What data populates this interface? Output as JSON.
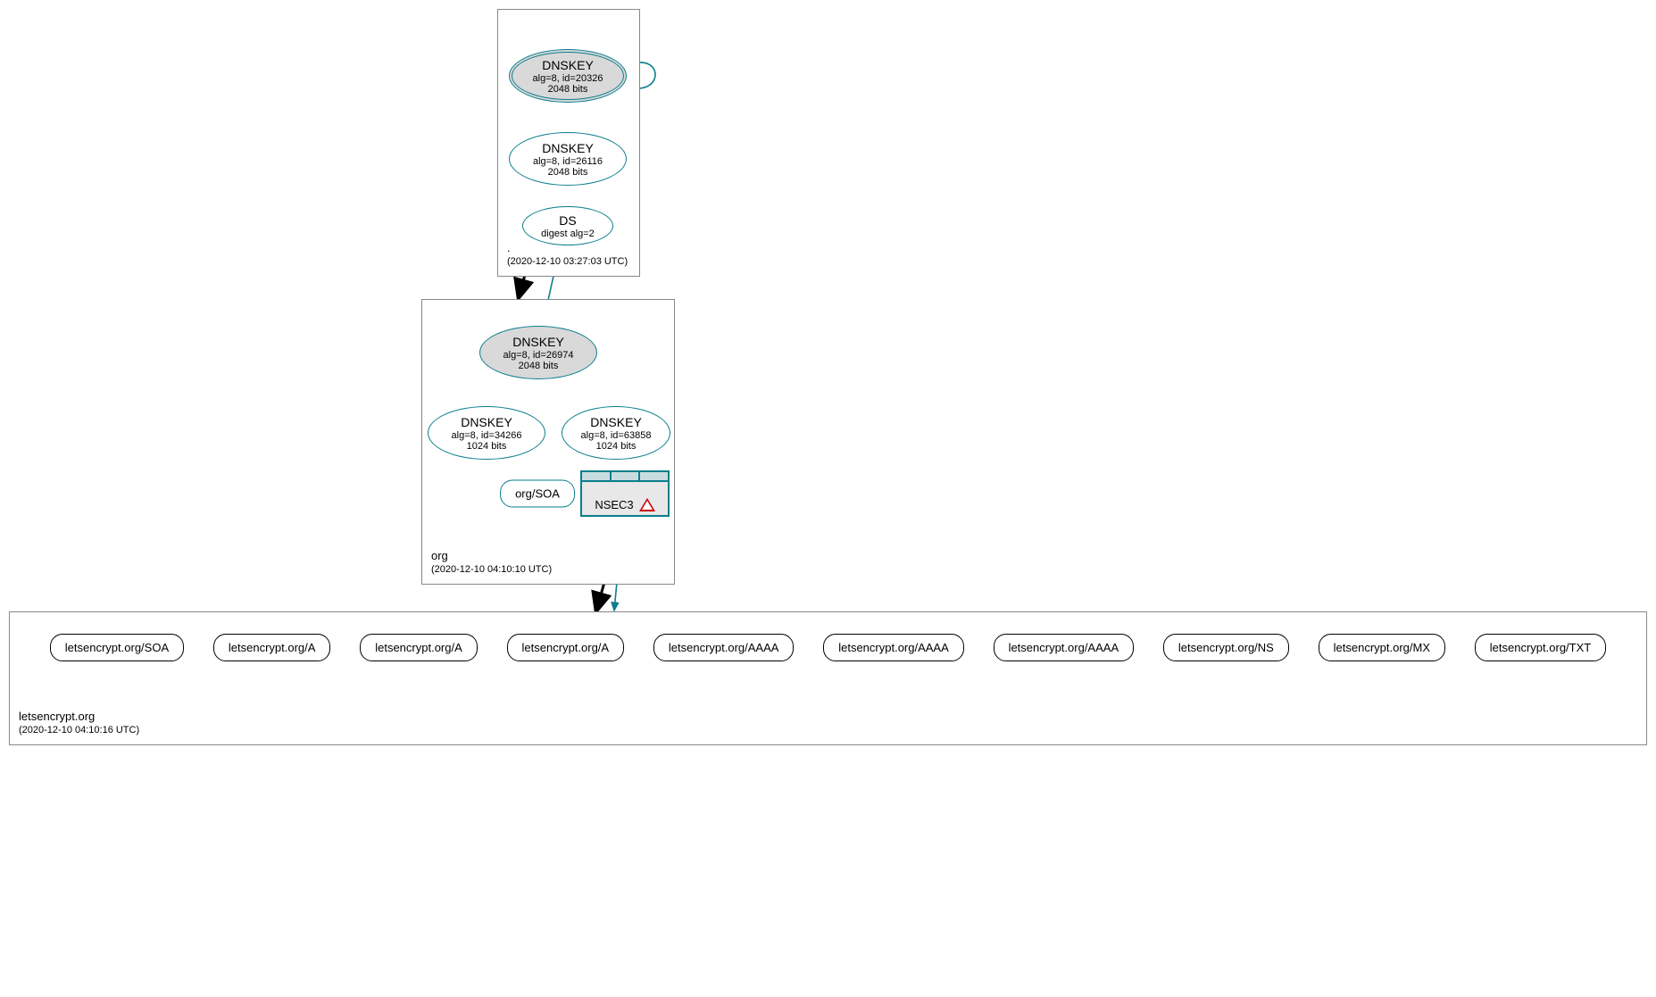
{
  "zones": {
    "root": {
      "name": ".",
      "timestamp": "(2020-12-10 03:27:03 UTC)"
    },
    "org": {
      "name": "org",
      "timestamp": "(2020-12-10 04:10:10 UTC)"
    },
    "le": {
      "name": "letsencrypt.org",
      "timestamp": "(2020-12-10 04:10:16 UTC)"
    }
  },
  "nodes": {
    "root_ksk": {
      "title": "DNSKEY",
      "line2": "alg=8, id=20326",
      "line3": "2048 bits"
    },
    "root_zsk": {
      "title": "DNSKEY",
      "line2": "alg=8, id=26116",
      "line3": "2048 bits"
    },
    "root_ds": {
      "title": "DS",
      "line2": "digest alg=2"
    },
    "org_ksk": {
      "title": "DNSKEY",
      "line2": "alg=8, id=26974",
      "line3": "2048 bits"
    },
    "org_zsk_a": {
      "title": "DNSKEY",
      "line2": "alg=8, id=34266",
      "line3": "1024 bits"
    },
    "org_zsk_b": {
      "title": "DNSKEY",
      "line2": "alg=8, id=63858",
      "line3": "1024 bits"
    },
    "org_soa": {
      "label": "org/SOA"
    },
    "nsec3": {
      "label": "NSEC3"
    }
  },
  "rrsets": {
    "items": [
      {
        "label": "letsencrypt.org/SOA"
      },
      {
        "label": "letsencrypt.org/A"
      },
      {
        "label": "letsencrypt.org/A"
      },
      {
        "label": "letsencrypt.org/A"
      },
      {
        "label": "letsencrypt.org/AAAA"
      },
      {
        "label": "letsencrypt.org/AAAA"
      },
      {
        "label": "letsencrypt.org/AAAA"
      },
      {
        "label": "letsencrypt.org/NS"
      },
      {
        "label": "letsencrypt.org/MX"
      },
      {
        "label": "letsencrypt.org/TXT"
      }
    ]
  },
  "colors": {
    "edge": "#0a7e8c"
  }
}
